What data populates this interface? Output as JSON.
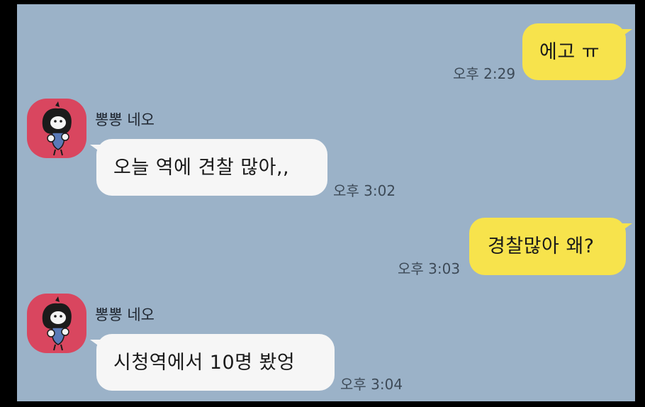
{
  "colors": {
    "chat_background": "#9bb2c8",
    "my_bubble": "#f7e34c",
    "their_bubble": "#f6f6f6",
    "avatar_background": "#d9465f"
  },
  "messages": [
    {
      "sender": "me",
      "text": "에고 ㅠ",
      "time": "오후 2:29"
    },
    {
      "sender": "뽕뽕 네오",
      "avatar_icon": "neo-character-icon",
      "text": "오늘 역에 견찰 많아,,",
      "time": "오후 3:02"
    },
    {
      "sender": "me",
      "text": "경찰많아 왜?",
      "time": "오후 3:03"
    },
    {
      "sender": "뽕뽕 네오",
      "avatar_icon": "neo-character-icon",
      "text": "시청역에서 10명 봤엉",
      "time": "오후 3:04"
    }
  ]
}
